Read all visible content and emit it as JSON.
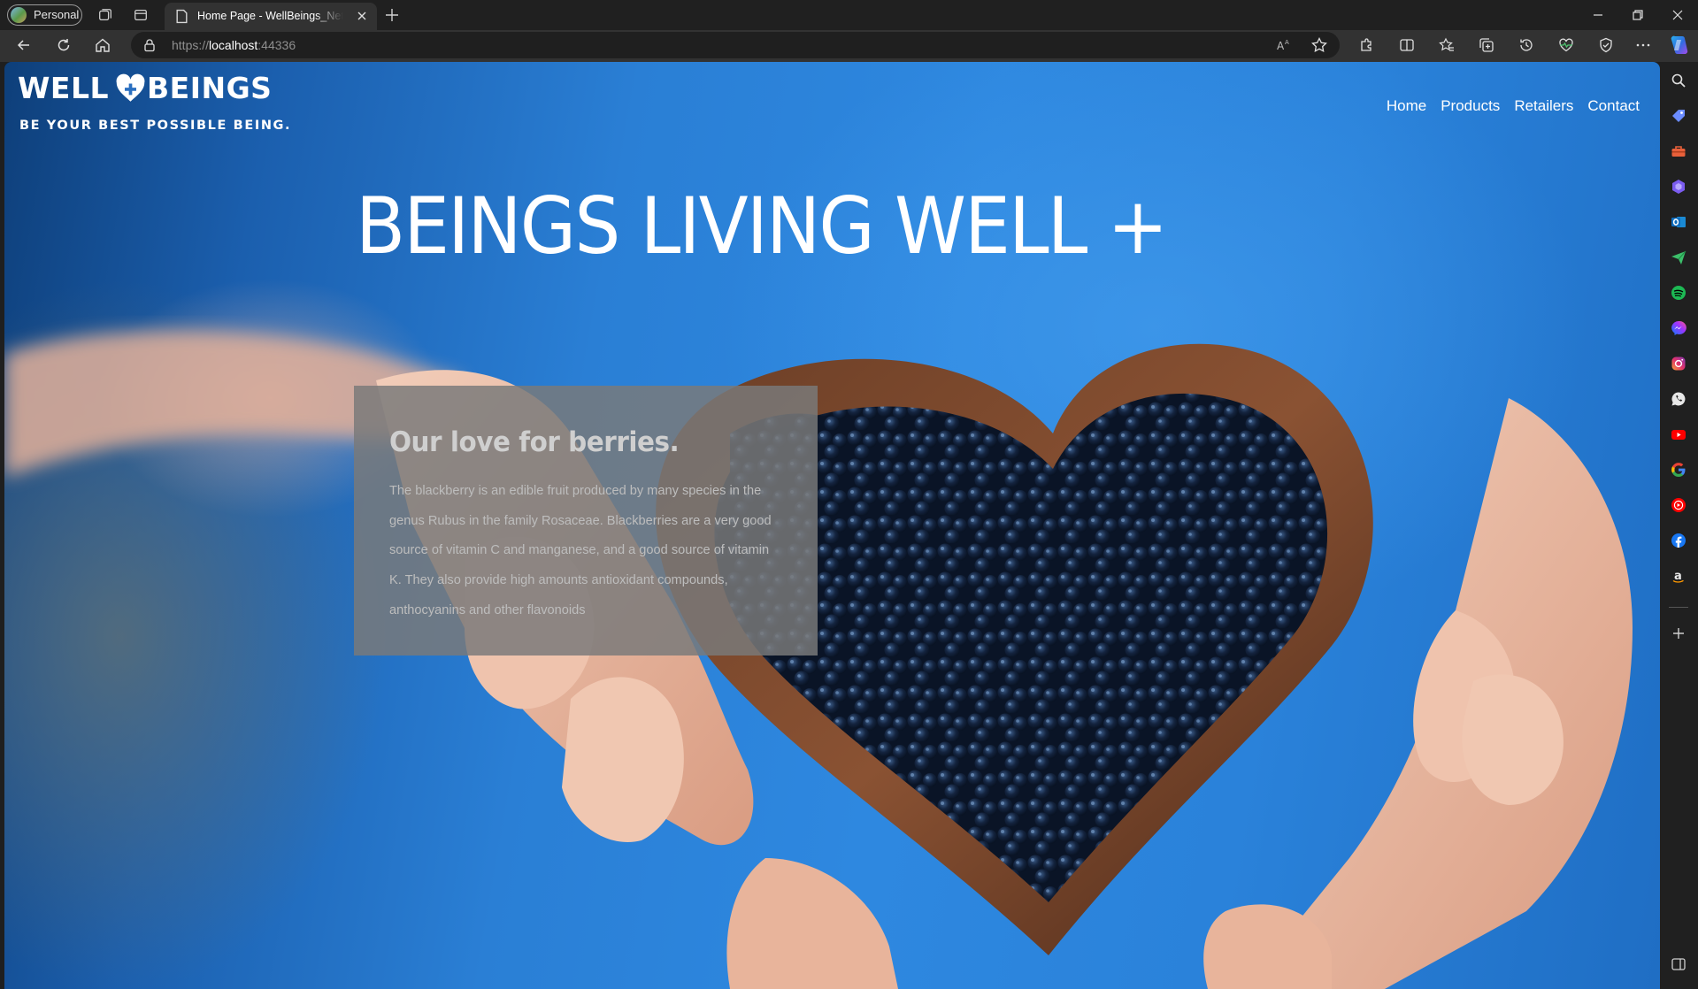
{
  "browser": {
    "profile_label": "Personal",
    "tab_title": "Home Page - WellBeings_NetCore",
    "url_prefix": "https://",
    "url_host": "localhost",
    "url_port": ":44336"
  },
  "site": {
    "logo_word_1": "WELL",
    "logo_word_2": "BEINGS",
    "tagline": "BE YOUR BEST POSSIBLE  BEING.",
    "nav": [
      "Home",
      "Products",
      "Retailers",
      "Contact"
    ],
    "hero_title": "BEINGS LIVING WELL +",
    "card_heading": "Our love for berries.",
    "card_body": "The blackberry is an edible fruit produced by many species in the genus Rubus in the family Rosaceae. Blackberries are a very good source of vitamin C and manganese, and a good source of vitamin K. They also provide high amounts antioxidant compounds, anthocyanins and other flavonoids"
  },
  "sidebar_icons": [
    "search-icon",
    "shopping-tag-icon",
    "toolbox-icon",
    "copilot-icon",
    "outlook-icon",
    "send-icon",
    "spotify-icon",
    "messenger-icon",
    "instagram-icon",
    "whatsapp-icon",
    "youtube-icon",
    "google-icon",
    "youtube-music-icon",
    "facebook-icon",
    "amazon-icon",
    "add-icon",
    "sidebar-toggle-icon"
  ],
  "colors": {
    "accent": "#2a82da",
    "card_bg": "#7a7a7a"
  }
}
